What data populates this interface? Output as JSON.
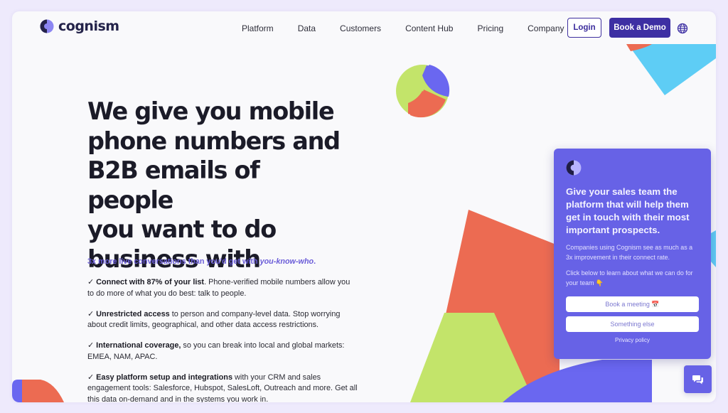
{
  "brand": {
    "name": "cognism",
    "colors": {
      "primary": "#3d2fa3",
      "accent": "#6762e6",
      "coral": "#ec6b52",
      "lime": "#c3e46a",
      "sky": "#5ecdf5",
      "text_dark": "#1b1b28"
    }
  },
  "header": {
    "nav": [
      {
        "label": "Platform"
      },
      {
        "label": "Data"
      },
      {
        "label": "Customers"
      },
      {
        "label": "Content Hub"
      },
      {
        "label": "Pricing"
      },
      {
        "label": "Company"
      }
    ],
    "login_label": "Login",
    "demo_label": "Book a Demo",
    "language_icon": "globe-icon"
  },
  "hero": {
    "title_lines": [
      "We give you mobile",
      "phone numbers and",
      "B2B emails of people",
      "you want to do",
      "business with"
    ],
    "tagline_prefix": "3x more live conversations than you'd get with ",
    "tagline_emphasis": "you-know-who",
    "tagline_suffix": ".",
    "features": [
      {
        "check": "✓",
        "bold": "Connect with 87% of your list",
        "text": ". Phone-verified mobile numbers allow you to do more of what you do best: talk to people."
      },
      {
        "check": "✓",
        "bold": "Unrestricted access",
        "text": " to person and company-level data. Stop worrying about credit limits, geographical, and other data access restrictions."
      },
      {
        "check": "✓",
        "bold": "International coverage,",
        "text": " so you can break into local and global markets: EMEA, NAM, APAC."
      },
      {
        "check": "✓",
        "bold": "Easy platform setup and integrations",
        "text": " with your CRM and sales engagement tools: Salesforce, Hubspot, SalesLoft, Outreach and more. Get all this data on-demand and in the systems you work in."
      }
    ]
  },
  "chat": {
    "heading": "Give your sales team the platform that will help them get in touch with their most important prospects.",
    "paragraph_1": "Companies using Cognism see as much as a 3x improvement in their connect rate.",
    "paragraph_2": "Click below to learn about what we can do for your team 👇",
    "buttons": [
      {
        "label": "Book a meeting 📅"
      },
      {
        "label": "Something else"
      }
    ],
    "privacy_label": "Privacy policy",
    "launcher_icon": "chat-bubbles-icon"
  }
}
